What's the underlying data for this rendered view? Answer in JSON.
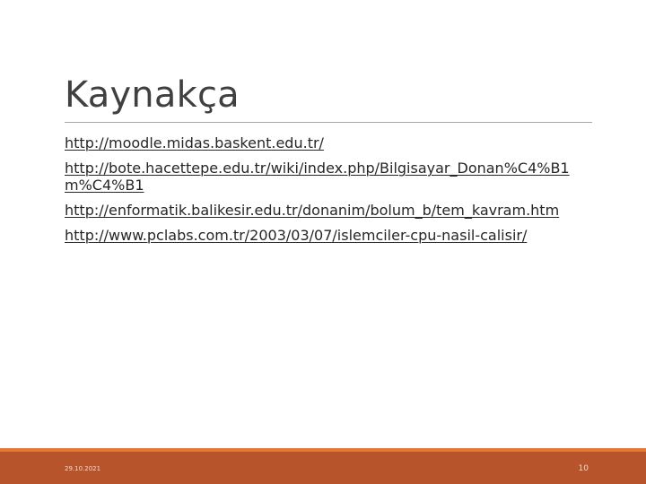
{
  "slide": {
    "title": "Kaynakça",
    "links": [
      "http://moodle.midas.baskent.edu.tr/",
      "http://bote.hacettepe.edu.tr/wiki/index.php/Bilgisayar_Donan%C4%B1m%C4%B1",
      "http://enformatik.balikesir.edu.tr/donanim/bolum_b/tem_kavram.htm",
      "http://www.pclabs.com.tr/2003/03/07/islemciler-cpu-nasil-calisir/"
    ]
  },
  "footer": {
    "date": "29.10.2021",
    "page_number": "10"
  },
  "colors": {
    "footer_bar": "#b8542c",
    "footer_accent": "#e07a36",
    "title_text": "#404040",
    "link_text": "#262626"
  }
}
